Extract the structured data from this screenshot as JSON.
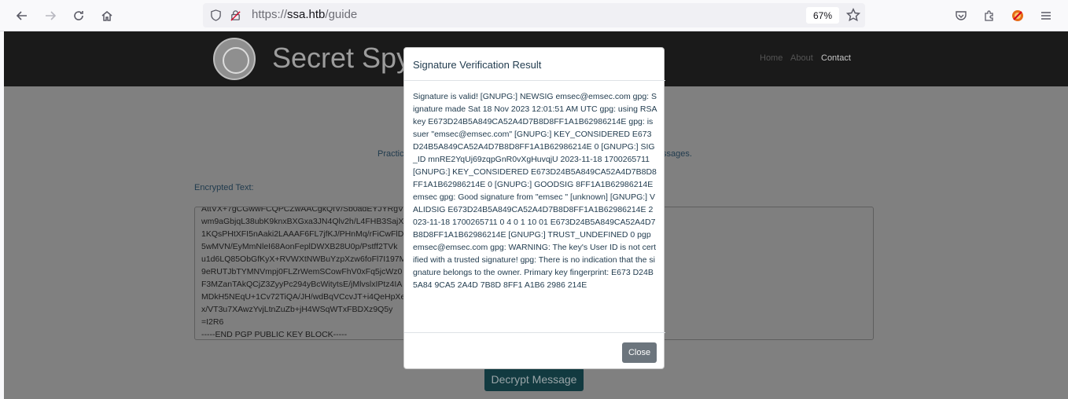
{
  "browser": {
    "url_scheme": "https://",
    "url_host": "ssa.htb",
    "url_path": "/guide",
    "zoom": "67%"
  },
  "site": {
    "title": "Secret Spy",
    "nav": [
      "Home",
      "About",
      "Contact"
    ],
    "body_text_left": "Practic",
    "body_text_right": "ssages.",
    "encrypted_label": "Encrypted Text:",
    "encrypted_lines": [
      "AttVX+7gCGwwFCQPCZwAACgkQfV/Sb0adEYJYRgV/",
      "wm9aGbjqL38ubK9knxBXGxa3JN4Qlv2h/L4FHB3SajX",
      "1KQsPHtXFI5nAaki2LAAAF6FL7jfKJ/PHnMq/rFiCwFlDh",
      "5wMVN/EyMmNleI68AonFeplDWXB28U0p/Pstff2TVk",
      "u1d6LQ85ObGfKyX+RVWXtNWBuYzpXzw6foFl7I197M",
      "9eRUTJbTYMNVmpj0FLZrWemSCowFhV0xFq5jcWz0",
      "F3MZanTAkQCjZ3ZyyPc294yBcWitytsE/jMlvslxIPtz4IA",
      "MDkH5NEqU+1Cv72TiQA/JH/wdBqVCcvJT+i4QeHpXe",
      "x/VT3u7XAwzYvjLtnZuZb+jH4WSqWTxFBDXz9Q5y",
      "=I2R6",
      "-----END PGP PUBLIC KEY BLOCK-----"
    ],
    "decrypt_button": "Decrypt Message"
  },
  "modal": {
    "title": "Signature Verification Result",
    "body": "Signature is valid! [GNUPG:] NEWSIG emsec@emsec.com gpg: Signature made Sat 18 Nov 2023 12:01:51 AM UTC gpg: using RSA key E673D24B5A849CA52A4D7B8D8FF1A1B62986214E gpg: issuer \"emsec@emsec.com\" [GNUPG:] KEY_CONSIDERED E673D24B5A849CA52A4D7B8D8FF1A1B62986214E 0 [GNUPG:] SIG_ID mnRE2YqUj69zqpGnR0vXgHuvqjU 2023-11-18 1700265711 [GNUPG:] KEY_CONSIDERED E673D24B5A849CA52A4D7B8D8FF1A1B62986214E 0 [GNUPG:] GOODSIG 8FF1A1B62986214E emsec gpg: Good signature from \"emsec \" [unknown] [GNUPG:] VALIDSIG E673D24B5A849CA52A4D7B8D8FF1A1B62986214E 2023-11-18 1700265711 0 4 0 1 10 01 E673D24B5A849CA52A4D7B8D8FF1A1B62986214E [GNUPG:] TRUST_UNDEFINED 0 pgp emsec@emsec.com gpg: WARNING: The key's User ID is not certified with a trusted signature! gpg: There is no indication that the signature belongs to the owner. Primary key fingerprint: E673 D24B 5A84 9CA5 2A4D 7B8D 8FF1 A1B6 2986 214E",
    "close_button": "Close"
  }
}
